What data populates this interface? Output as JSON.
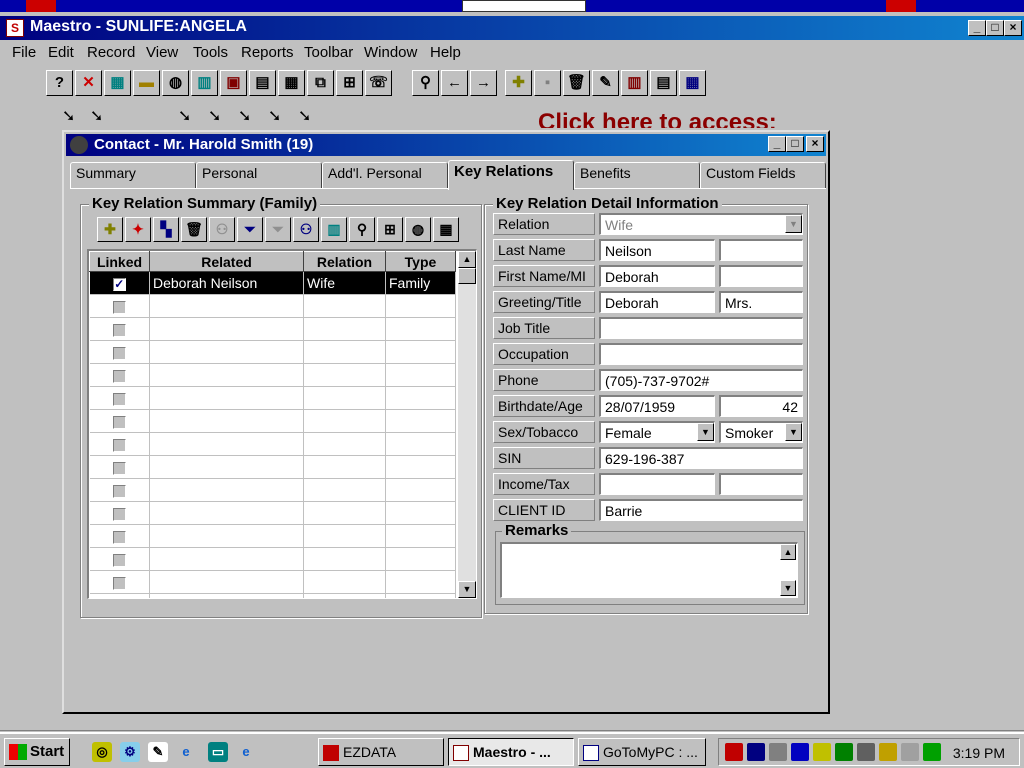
{
  "main_window": {
    "title": "Maestro - SUNLIFE:ANGELA",
    "menu": [
      "File",
      "Edit",
      "Record",
      "View",
      "Tools",
      "Reports",
      "Toolbar",
      "Window",
      "Help"
    ]
  },
  "banner": {
    "click_here": "Click here to access:"
  },
  "contact_window": {
    "title": "Contact - Mr. Harold Smith (19)",
    "tabs": [
      "Summary",
      "Personal",
      "Add'l. Personal",
      "Key Relations",
      "Benefits",
      "Custom Fields"
    ],
    "active_tab": "Key Relations"
  },
  "summary": {
    "group_title": "Key Relation Summary (Family)",
    "columns": [
      "Linked",
      "Related",
      "Relation",
      "Type"
    ],
    "rows": [
      {
        "linked": true,
        "related": "Deborah Neilson",
        "relation": "Wife",
        "type": "Family"
      }
    ],
    "empty_row_count": 14
  },
  "detail": {
    "group_title": "Key Relation Detail Information",
    "labels": {
      "relation": "Relation",
      "last_name": "Last Name",
      "first_name": "First Name/MI",
      "greeting": "Greeting/Title",
      "job_title": "Job Title",
      "occupation": "Occupation",
      "phone": "Phone",
      "birthdate": "Birthdate/Age",
      "sex": "Sex/Tobacco",
      "sin": "SIN",
      "income": "Income/Tax",
      "client_id": "CLIENT ID",
      "remarks": "Remarks"
    },
    "values": {
      "relation": "Wife",
      "last_name": "Neilson",
      "last_name_2": "",
      "first_name": "Deborah",
      "middle_initial": "",
      "greeting": "Deborah",
      "title": "Mrs.",
      "job_title": "",
      "occupation": "",
      "phone": "(705)-737-9702#",
      "birthdate": "28/07/1959",
      "age": "42",
      "sex": "Female",
      "tobacco": "Smoker",
      "sin": "629-196-387",
      "income": "",
      "tax": "",
      "client_id": "Barrie",
      "remarks": ""
    }
  },
  "taskbar": {
    "start": "Start",
    "tasks": [
      "EZDATA",
      "Maestro - ...",
      "GoToMyPC : ..."
    ],
    "clock": "3:19 PM"
  }
}
